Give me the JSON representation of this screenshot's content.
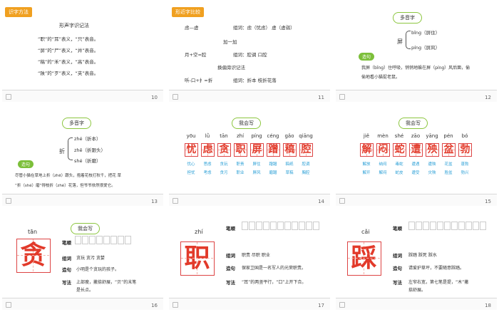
{
  "slides": {
    "s10": {
      "number": "10",
      "tag": "识字方法",
      "heading": "形声字识记法",
      "lines": [
        "“职”的“耳”表义，“只”表音。",
        "“屏”的“尸”表义，“并”表音。",
        "“稿”的“禾”表义，“高”表音。",
        "“陕”的“歹”表义，“夹”表音。"
      ]
    },
    "s11": {
      "number": "11",
      "tag": "形近字比较",
      "row1_left": "虑—虚",
      "row1_right": "组词：虑（忧虑） 虚（虚弱）",
      "heading2": "加一加",
      "row2_left": "月+空=腔",
      "row2_right": "组词：腔调 口腔",
      "heading3": "换偏旁识记法",
      "row3_left": "听-口+扌=折",
      "row3_right": "组词：折本 枝折花落"
    },
    "s12": {
      "number": "12",
      "title": "多音字",
      "char": "屏",
      "reading1": "bǐng（屏住）",
      "reading2": "píng（屏风）",
      "btn": "造句",
      "sentence_a": "我屏（bǐng）住呼吸，悄悄地躲在屏（píng）风后面，偷",
      "sentence_b": "偷地看小猫捉老鼠。"
    },
    "s13": {
      "number": "13",
      "title": "多音字",
      "char": "折",
      "reading1": "zhé（折本）",
      "reading2": "zhē（折跟头）",
      "reading3": "shé（折磨）",
      "btn": "造句",
      "sentence_a": "尽管小猫在草地上折（zhē）跟头，抱着花枝打秋千，把花  草",
      "sentence_b": "“折（shé）磨”得枝折（zhé）花落，但爷爷依然很爱它。"
    },
    "s14": {
      "number": "14",
      "title": "我会写",
      "chars": [
        {
          "py": "yōu",
          "ch": "忧",
          "w1": "忧心",
          "w2": "担忧"
        },
        {
          "py": "lǜ",
          "ch": "虑",
          "w1": "思虑",
          "w2": "考虑"
        },
        {
          "py": "tān",
          "ch": "贪",
          "w1": "贪玩",
          "w2": "贪污"
        },
        {
          "py": "zhí",
          "ch": "职",
          "w1": "职责",
          "w2": "职业"
        },
        {
          "py": "píng",
          "ch": "屏",
          "w1": "屏住",
          "w2": "屏风"
        },
        {
          "py": "céng",
          "ch": "蹭",
          "w1": "蹭蹭",
          "w2": "磨蹭"
        },
        {
          "py": "gǎo",
          "ch": "稿",
          "w1": "稿纸",
          "w2": "草稿"
        },
        {
          "py": "qiāng",
          "ch": "腔",
          "w1": "腔调",
          "w2": "胸腔"
        }
      ]
    },
    "s15": {
      "number": "15",
      "title": "我会写",
      "chars": [
        {
          "py": "jiě",
          "ch": "解",
          "w1": "解放",
          "w2": "解开"
        },
        {
          "py": "mèn",
          "ch": "闷",
          "w1": "纳闷",
          "w2": "解闷"
        },
        {
          "py": "shé",
          "ch": "蛇",
          "w1": "毒蛇",
          "w2": "蛇皮"
        },
        {
          "py": "zāo",
          "ch": "遭",
          "w1": "遭遇",
          "w2": "遭受"
        },
        {
          "py": "yāng",
          "ch": "殃",
          "w1": "遭殃",
          "w2": "灾殃"
        },
        {
          "py": "pén",
          "ch": "盆",
          "w1": "花盆",
          "w2": "脸盆"
        },
        {
          "py": "bó",
          "ch": "勃",
          "w1": "蓬勃",
          "w2": "勃兴"
        }
      ]
    },
    "s16": {
      "number": "16",
      "title": "我会写",
      "pinyin": "tān",
      "char": "贪",
      "l_strokes": "笔顺",
      "l_words": "组词",
      "words": "贪玩  贪污  贪婪",
      "l_sent": "造句",
      "sentence": "小明是个贪玩的孩子。",
      "l_write": "写法",
      "write_a": "上部瘦，撇捺舒展，“贝”的末笔",
      "write_b": "是长点。"
    },
    "s17": {
      "number": "17",
      "pinyin": "zhí",
      "char": "职",
      "l_strokes": "笔顺",
      "l_words": "组词",
      "words": "职责  尽职  职业",
      "l_sent": "造句",
      "sentence": "保家卫国是一名军人的光荣职责。",
      "l_write": "写法",
      "write": "“耳”的两竖平行，“口”上开下合。"
    },
    "s18": {
      "number": "18",
      "pinyin": "cǎi",
      "char": "踩",
      "l_strokes": "笔顺",
      "l_words": "组词",
      "words": "踩踏  踩死  踩水",
      "l_sent": "造句",
      "sentence": "请爱护草坪，不要随意踩踏。",
      "l_write": "写法",
      "write_a": "左窄右宽，第七笔是提，“木”撇",
      "write_b": "捺舒展。"
    }
  },
  "colors": {
    "accent_orange": "#f0a020",
    "accent_green": "#8cc63f",
    "red": "#e23a2a",
    "blue": "#2a9fd6"
  }
}
